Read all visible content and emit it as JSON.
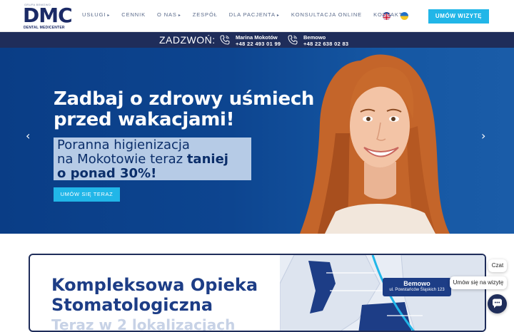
{
  "brand": {
    "group_label": "Grupa Bemowo",
    "mark": "DMC",
    "name": "DENTAL MEDICENTER"
  },
  "nav": {
    "items": [
      {
        "label": "Usługi",
        "caret": "▸"
      },
      {
        "label": "Cennik",
        "caret": ""
      },
      {
        "label": "O nas",
        "caret": "▸"
      },
      {
        "label": "Zespół",
        "caret": ""
      },
      {
        "label": "Dla pacjenta",
        "caret": "▸"
      },
      {
        "label": "Konsultacja online",
        "caret": ""
      },
      {
        "label": "Kontakt",
        "caret": "▸"
      }
    ],
    "cta": "Umów wizytę"
  },
  "callbar": {
    "label": "Zadzwoń:",
    "locations": [
      {
        "name": "Marina Mokotów",
        "phone": "+48 22 493 01 99"
      },
      {
        "name": "Bemowo",
        "phone": "+48 22 638 02 83"
      }
    ]
  },
  "hero": {
    "title_line1": "Zadbaj o zdrowy uśmiech",
    "title_line2": "przed wakacjami!",
    "box_line1": "Poranna higienizacja",
    "box_line2_plain": "na Mokotowie teraz ",
    "box_line2_bold": "taniej",
    "box_line3": "o ponad 30%!",
    "cta": "Umów się teraz",
    "prev_arrow": "‹",
    "next_arrow": "›"
  },
  "section": {
    "title_line1": "Kompleksowa Opieka",
    "title_line2": "Stomatologiczna",
    "subtitle": "Teraz w 2 lokalizacjach",
    "map_label_name": "Bemowo",
    "map_label_address": "ul. Powstańców Śląskich 123"
  },
  "chat": {
    "chat_label": "Czat",
    "appointment_label": "Umów się na wizytę"
  },
  "colors": {
    "navy": "#1f2d5a",
    "accent": "#21b6e8",
    "hero_blue": "#0d4590"
  }
}
